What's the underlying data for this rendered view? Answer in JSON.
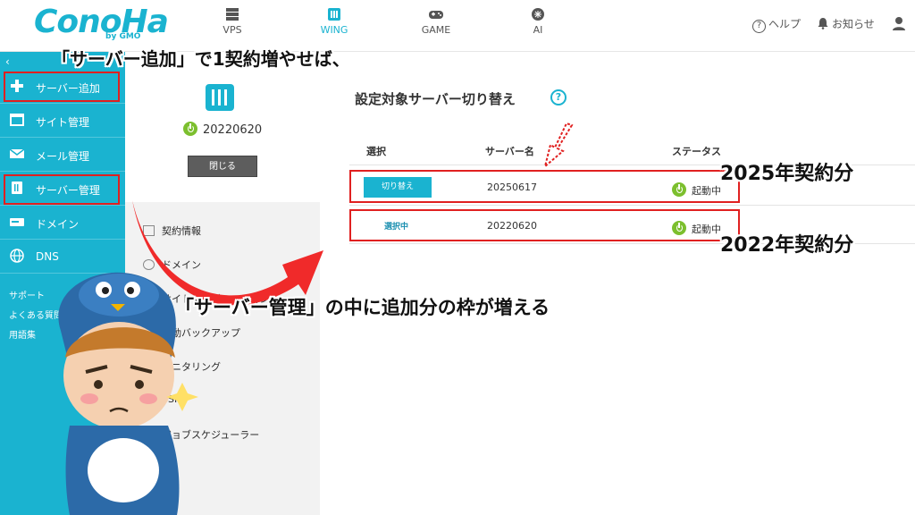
{
  "header": {
    "logo": "ConoHa",
    "logo_sub": "by GMO",
    "nav": [
      {
        "label": "VPS",
        "icon": "server-rack-icon",
        "active": false
      },
      {
        "label": "WING",
        "icon": "wing-server-icon",
        "active": true
      },
      {
        "label": "GAME",
        "icon": "gamepad-icon",
        "active": false
      },
      {
        "label": "AI",
        "icon": "ai-chip-icon",
        "active": false
      }
    ],
    "help_label": "ヘルプ",
    "notice_label": "お知らせ"
  },
  "sidebar": {
    "items": [
      {
        "label": "サーバー追加",
        "icon": "plus-icon"
      },
      {
        "label": "サイト管理",
        "icon": "window-icon"
      },
      {
        "label": "メール管理",
        "icon": "mail-icon"
      },
      {
        "label": "サーバー管理",
        "icon": "server-icon"
      },
      {
        "label": "ドメイン",
        "icon": "domain-icon"
      },
      {
        "label": "DNS",
        "icon": "globe-icon"
      }
    ],
    "support_label": "サポート",
    "faq_label": "よくある質問",
    "glossary_label": "用語集"
  },
  "server_panel": {
    "server_name": "20220620",
    "close_label": "閉じる",
    "menu": [
      {
        "label": "契約情報"
      },
      {
        "label": "ドメイン"
      },
      {
        "label": "サイトマイグレーション"
      },
      {
        "label": "自動バックアップ"
      },
      {
        "label": "モニタリング"
      },
      {
        "label": "SSH"
      },
      {
        "label": "ジョブスケジューラー"
      }
    ]
  },
  "main": {
    "title": "設定対象サーバー切り替え",
    "columns": [
      "選択",
      "サーバー名",
      "ステータス"
    ],
    "rows": [
      {
        "action": "切り替え",
        "server": "20250617",
        "status": "起動中"
      },
      {
        "action": "選択中",
        "server": "20220620",
        "status": "起動中"
      }
    ]
  },
  "annotations": {
    "top_caption": "「サーバー追加」で1契約増やせば、",
    "middle_caption": "「サーバー管理」の中に追加分の枠が増える",
    "label_2025": "2025年契約分",
    "label_2022": "2022年契約分"
  },
  "colors": {
    "accent": "#1ab3d0",
    "highlight": "#e02020",
    "status_green": "#7cbf2e"
  }
}
